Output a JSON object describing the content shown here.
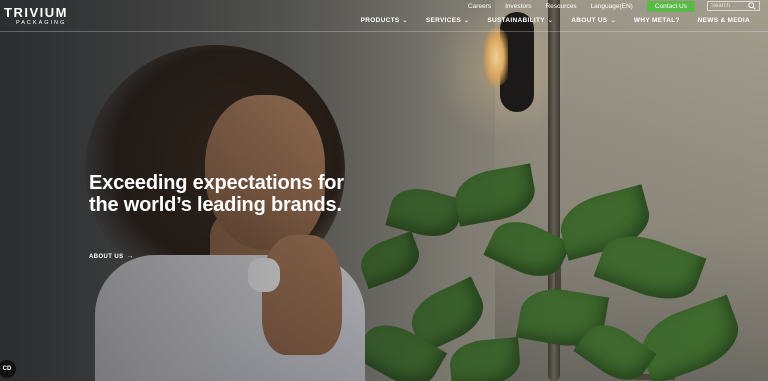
{
  "brand": {
    "name": "TRIVIUM",
    "tagline": "PACKAGING"
  },
  "utility_nav": {
    "links": [
      "Careers",
      "Investors",
      "Resources",
      "Language(EN)"
    ],
    "contact_label": "Contact Us",
    "search_placeholder": "Search"
  },
  "main_nav": [
    {
      "label": "PRODUCTS",
      "has_dropdown": true
    },
    {
      "label": "SERVICES",
      "has_dropdown": true
    },
    {
      "label": "SUSTAINABILITY",
      "has_dropdown": true
    },
    {
      "label": "ABOUT US",
      "has_dropdown": true
    },
    {
      "label": "WHY METAL?",
      "has_dropdown": false
    },
    {
      "label": "NEWS & MEDIA",
      "has_dropdown": false
    }
  ],
  "hero": {
    "headline": "Exceeding expectations for the world’s leading brands.",
    "cta_label": "ABOUT US"
  },
  "cookie_badge": {
    "label": "CD"
  },
  "colors": {
    "accent": "#5ab847",
    "text": "#ffffff"
  }
}
